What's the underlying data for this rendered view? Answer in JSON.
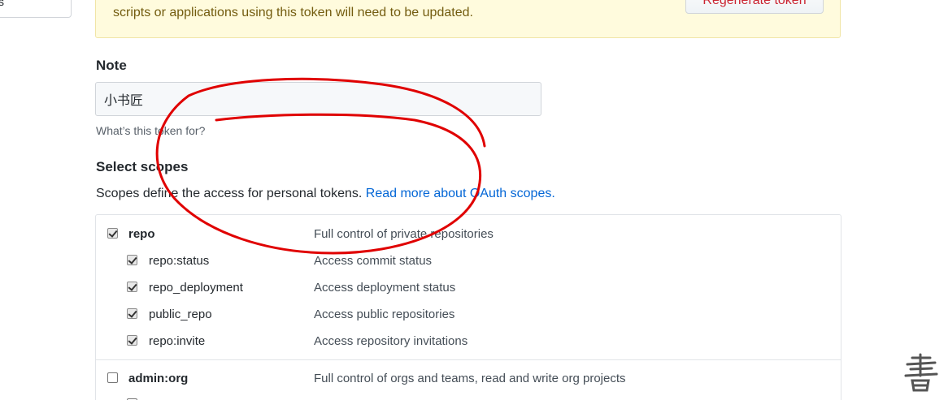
{
  "sidebar": {
    "glyph": "s"
  },
  "warning": {
    "text": "scripts or applications using this token will need to be updated.",
    "regenerate_label": "Regenerate token"
  },
  "note": {
    "label": "Note",
    "value": "小书匠",
    "hint": "What’s this token for?"
  },
  "scopes": {
    "heading": "Select scopes",
    "description": "Scopes define the access for personal tokens.",
    "link": "Read more about OAuth scopes.",
    "groups": [
      {
        "name": "repo",
        "description": "Full control of private repositories",
        "checked": true,
        "children": [
          {
            "name": "repo:status",
            "description": "Access commit status",
            "checked": true
          },
          {
            "name": "repo_deployment",
            "description": "Access deployment status",
            "checked": true
          },
          {
            "name": "public_repo",
            "description": "Access public repositories",
            "checked": true
          },
          {
            "name": "repo:invite",
            "description": "Access repository invitations",
            "checked": true
          }
        ]
      },
      {
        "name": "admin:org",
        "description": "Full control of orgs and teams, read and write org projects",
        "checked": false,
        "children": []
      }
    ]
  },
  "annotation": {
    "stroke_color": "#e00000"
  },
  "colors": {
    "link": "#0366d6",
    "warning_bg": "#fffbdd",
    "danger": "#cb2431"
  }
}
